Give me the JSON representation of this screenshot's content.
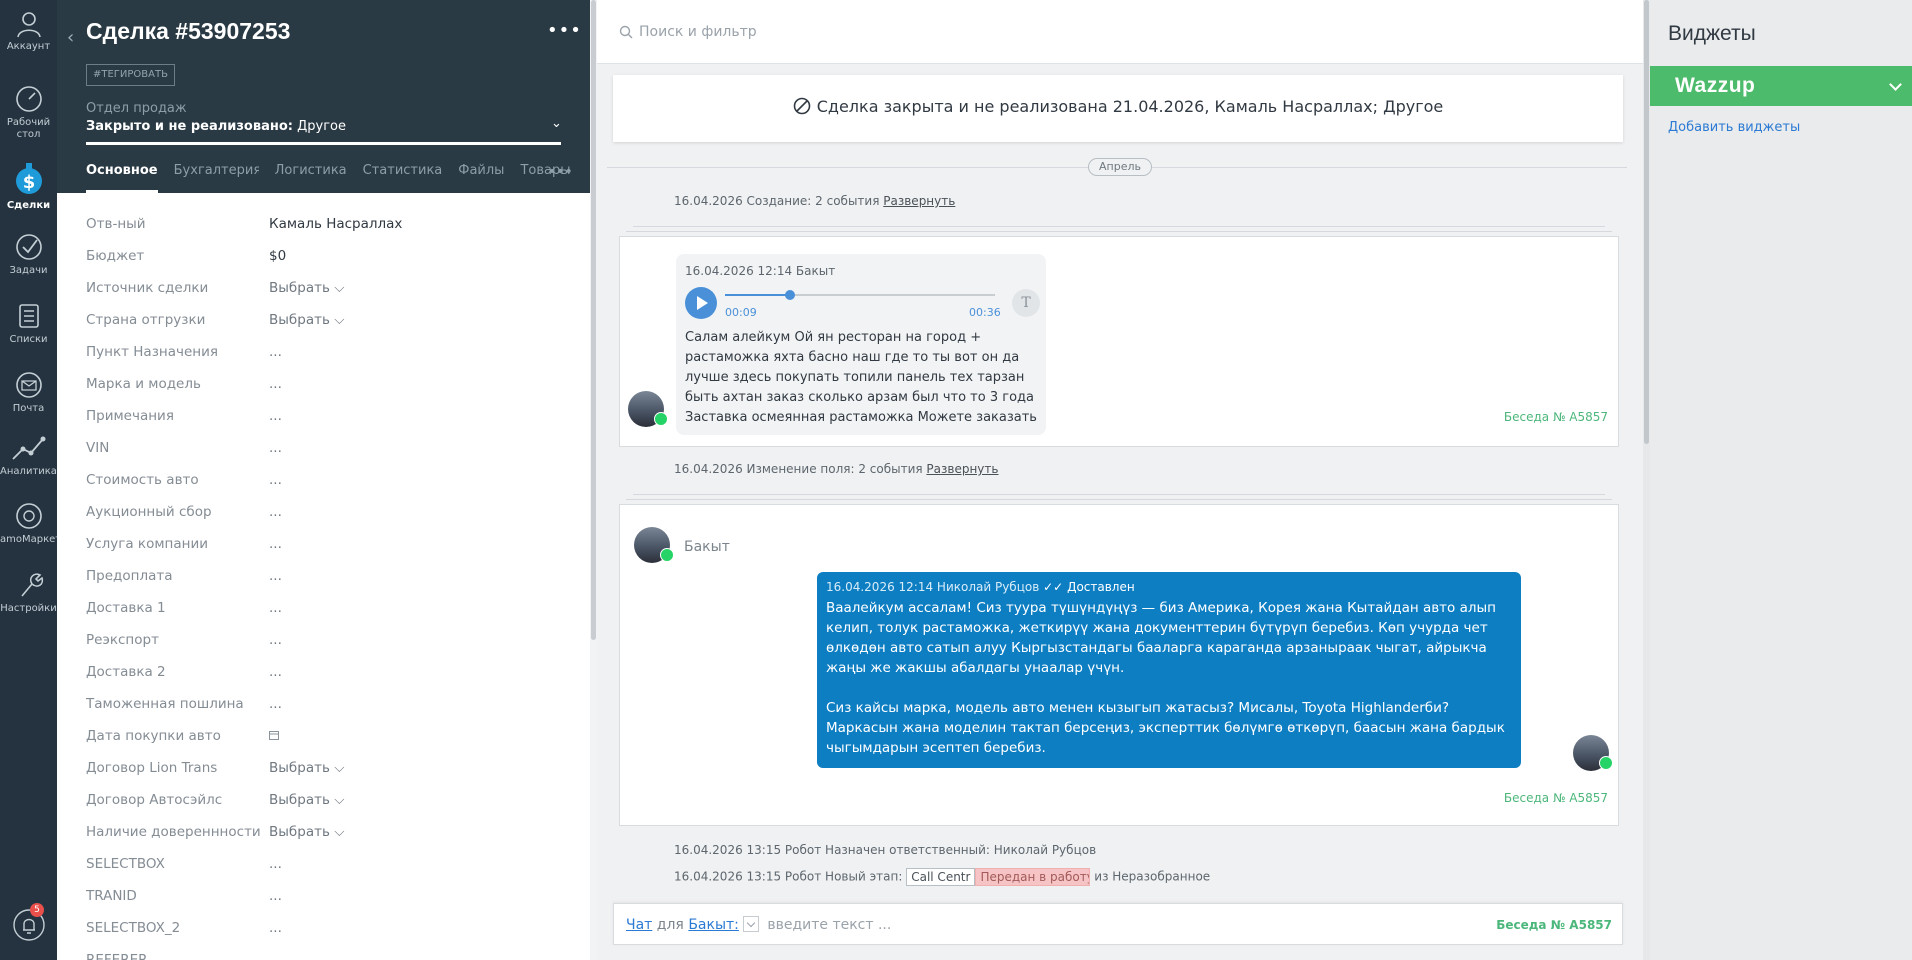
{
  "nav": {
    "items": [
      {
        "label": "Аккаунт",
        "icon": "user-icon"
      },
      {
        "label": "Рабочий\nстол",
        "icon": "dashboard-icon"
      },
      {
        "label": "Сделки",
        "icon": "deals-icon"
      },
      {
        "label": "Задачи",
        "icon": "tasks-icon"
      },
      {
        "label": "Списки",
        "icon": "lists-icon"
      },
      {
        "label": "Почта",
        "icon": "mail-icon"
      },
      {
        "label": "Аналитика",
        "icon": "analytics-icon"
      },
      {
        "label": "amoМаркет",
        "icon": "market-icon"
      },
      {
        "label": "Настройки",
        "icon": "settings-icon"
      }
    ],
    "notifications_count": "5"
  },
  "lead": {
    "title": "Сделка #53907253",
    "tag_button": "#ТЕГИРОВАТЬ",
    "pipeline_label": "Отдел продаж",
    "status_prefix": "Закрыто и не реализовано:",
    "status_reason": "Другое",
    "tabs": [
      "Основное",
      "Бухгалтерия",
      "Логистика",
      "Статистика",
      "Файлы",
      "Товары"
    ],
    "fields": [
      {
        "label": "Отв-ный",
        "value": "Камаль Насраллах"
      },
      {
        "label": "Бюджет",
        "value": "$0"
      },
      {
        "label": "Источник сделки",
        "value": "Выбрать"
      },
      {
        "label": "Страна отгрузки",
        "value": "Выбрать"
      },
      {
        "label": "Пункт Назначения",
        "value": "..."
      },
      {
        "label": "Марка и модель",
        "value": "..."
      },
      {
        "label": "Примечания",
        "value": "..."
      },
      {
        "label": "VIN",
        "value": "..."
      },
      {
        "label": "Стоимость авто",
        "value": "..."
      },
      {
        "label": "Аукционный сбор",
        "value": "..."
      },
      {
        "label": "Услуга компании",
        "value": "..."
      },
      {
        "label": "Предоплата",
        "value": "..."
      },
      {
        "label": "Доставка 1",
        "value": "..."
      },
      {
        "label": "Реэкспорт",
        "value": "..."
      },
      {
        "label": "Доставка 2",
        "value": "..."
      },
      {
        "label": "Таможенная пошлина",
        "value": "..."
      },
      {
        "label": "Дата покупки авто",
        "value": ""
      },
      {
        "label": "Договор Lion Trans",
        "value": "Выбрать"
      },
      {
        "label": "Договор Автосэйлс",
        "value": "Выбрать"
      },
      {
        "label": "Наличие довереннности",
        "value": "Выбрать"
      },
      {
        "label": "SELECTBOX",
        "value": "..."
      },
      {
        "label": "TRANID",
        "value": "..."
      },
      {
        "label": "SELECTBOX_2",
        "value": "..."
      },
      {
        "label": "REFERER",
        "value": ""
      }
    ]
  },
  "feed": {
    "search_placeholder": "Поиск и фильтр",
    "closed_banner": "Сделка закрыта и не реализована 21.04.2026, Камаль Насраллах; Другое",
    "month": "Апрель",
    "note_created": "16.04.2026 Создание: 2 события",
    "note_field_change": "16.04.2026 Изменение поля: 2 события",
    "expand_link": "Развернуть",
    "voice_message": {
      "header": "16.04.2026 12:14 Бакыт",
      "time_current": "00:09",
      "time_total": "00:36",
      "progress": 0.24,
      "transcribe_label": "T",
      "text": "Салам алейкум Ой ян ресторан на город + растаможка яхта басно наш где то ты вот он да лучше здесь покупать топили панель тех тарзан быть ахтан заказ сколько арзам был что то 3 года Заставка осмеянная растаможка Можете заказать",
      "conversation": "Беседа № A5857"
    },
    "chat_block": {
      "contact_name": "Бакыт",
      "out_header": "16.04.2026 12:14 Николай Рубцов",
      "out_status": "Доставлен",
      "out_text_1": "Ваалейкум ассалам! Сиз туура түшүндүңүз — биз Америка, Корея жана Кытайдан авто алып келип, толук растаможка, жеткирүү жана документтерин бүтүрүп беребиз. Көп учурда чет өлкөдөн авто сатып алуу Кыргызстандагы бааларга караганда арзаныраак чыгат, айрыкча жаңы же жакшы абалдагы унаалар үчүн.",
      "out_text_2": "Сиз кайсы марка, модель авто менен кызыгып жатасыз? Мисалы, Toyota Highlanderби? Маркасын жана моделин тактап берсеңиз, эксперттик бөлүмгө өткөрүп, баасын жана бардык чыгымдарын эсептеп беребиз.",
      "conversation": "Беседа № A5857"
    },
    "robot_note_1": "16.04.2026 13:15 Робот Назначен ответственный: Николай Рубцов",
    "robot_note_2_prefix": "16.04.2026 13:15 Робот Новый этап:",
    "robot_stage_from": "Call Centr",
    "robot_stage_to": "Передан в работу",
    "robot_note_2_suffix": "из Неразобранное",
    "composer": {
      "mode_link": "Чат",
      "for_word": "для",
      "contact_link": "Бакыт:",
      "placeholder": "введите текст ...",
      "conversation": "Беседа № A5857"
    }
  },
  "widgets": {
    "title": "Виджеты",
    "wazzup": "Wazzup",
    "add_widgets": "Добавить виджеты"
  },
  "colors": {
    "nav_bg": "#24333f",
    "card_head_bg": "#2a3a45",
    "outgoing_bubble": "#0e7ec3",
    "wazzup_green": "#4dbb6c",
    "conversation_green": "#4cb77b",
    "link_blue": "#2b7ad3"
  }
}
